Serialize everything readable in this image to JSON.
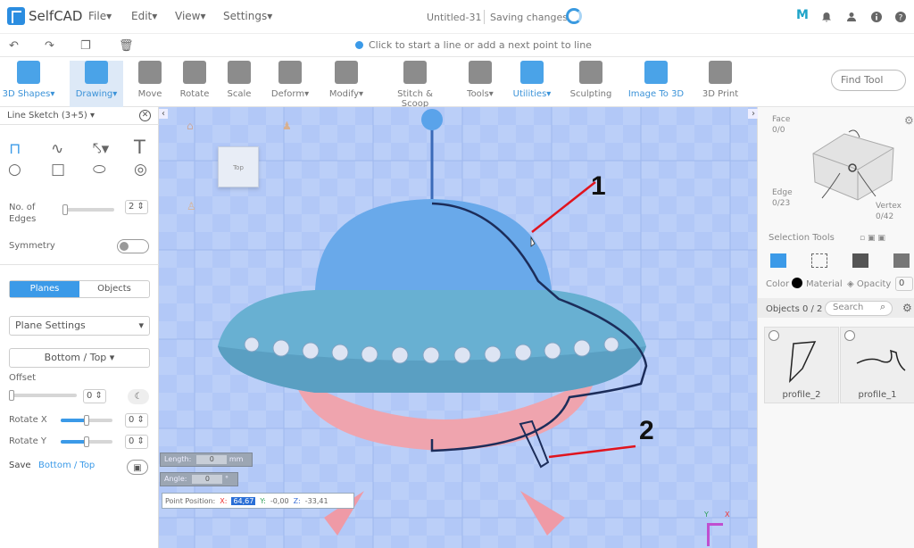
{
  "app": {
    "name": "SelfCAD",
    "doc_title": "Untitled-31",
    "status": "Saving changes",
    "user_initial": "M"
  },
  "menu": {
    "file": "File",
    "edit": "Edit",
    "view": "View",
    "settings": "Settings"
  },
  "hint": "Click to start a line or add a next point to line",
  "toolbar": [
    {
      "label": "3D Shapes",
      "icon": "cube-icon"
    },
    {
      "label": "Drawing",
      "icon": "drawing-icon"
    },
    {
      "label": "Move",
      "icon": "move-icon"
    },
    {
      "label": "Rotate",
      "icon": "rotate-icon"
    },
    {
      "label": "Scale",
      "icon": "scale-icon"
    },
    {
      "label": "Deform",
      "icon": "deform-icon"
    },
    {
      "label": "Modify",
      "icon": "modify-icon"
    },
    {
      "label": "Stitch & Scoop",
      "icon": "stitch-icon"
    },
    {
      "label": "Tools",
      "icon": "tools-icon"
    },
    {
      "label": "Utilities",
      "icon": "utilities-icon"
    },
    {
      "label": "Sculpting",
      "icon": "sculpting-icon"
    },
    {
      "label": "Image To 3D",
      "icon": "image-icon"
    },
    {
      "label": "3D Print",
      "icon": "printer-icon"
    }
  ],
  "find_tool": "Find Tool",
  "left_panel": {
    "title": "Line Sketch (3+5)",
    "edges_label": "No. of Edges",
    "edges_value": "2",
    "symmetry_label": "Symmetry",
    "tab_planes": "Planes",
    "tab_objects": "Objects",
    "plane_settings": "Plane Settings",
    "plane_view": "Bottom / Top",
    "offset_label": "Offset",
    "offset_value": "0",
    "rotate_x_label": "Rotate X",
    "rotate_x_value": "0",
    "rotate_y_label": "Rotate Y",
    "rotate_y_value": "0",
    "save_label": "Save",
    "save_plane": "Bottom / Top"
  },
  "hud": {
    "length_label": "Length:",
    "length_value": "0",
    "length_unit": "mm",
    "angle_label": "Angle:",
    "angle_value": "0",
    "angle_unit": "°",
    "point_label": "Point Position:",
    "x_label": "X:",
    "x_value": "64,67",
    "y_label": "Y:",
    "y_value": "-0,00",
    "z_label": "Z:",
    "z_value": "-33,41"
  },
  "viewcube_label": "Top",
  "callouts": [
    "1",
    "2"
  ],
  "axis": {
    "y": "Y",
    "x": "X"
  },
  "right_panel": {
    "face_label": "Face",
    "face_value": "0/0",
    "edge_label": "Edge",
    "edge_value": "0/23",
    "vertex_label": "Vertex",
    "vertex_value": "0/42",
    "selection_tools": "Selection Tools",
    "color_label": "Color",
    "material_label": "Material",
    "opacity_label": "Opacity",
    "opacity_value": "0",
    "objects_label": "Objects 0 / 2",
    "search_placeholder": "Search",
    "objects": [
      "profile_2",
      "profile_1"
    ]
  },
  "colors": {
    "accent": "#3b9ae8",
    "canvas": "#b2c8f7",
    "callout_line": "#e0141e"
  }
}
